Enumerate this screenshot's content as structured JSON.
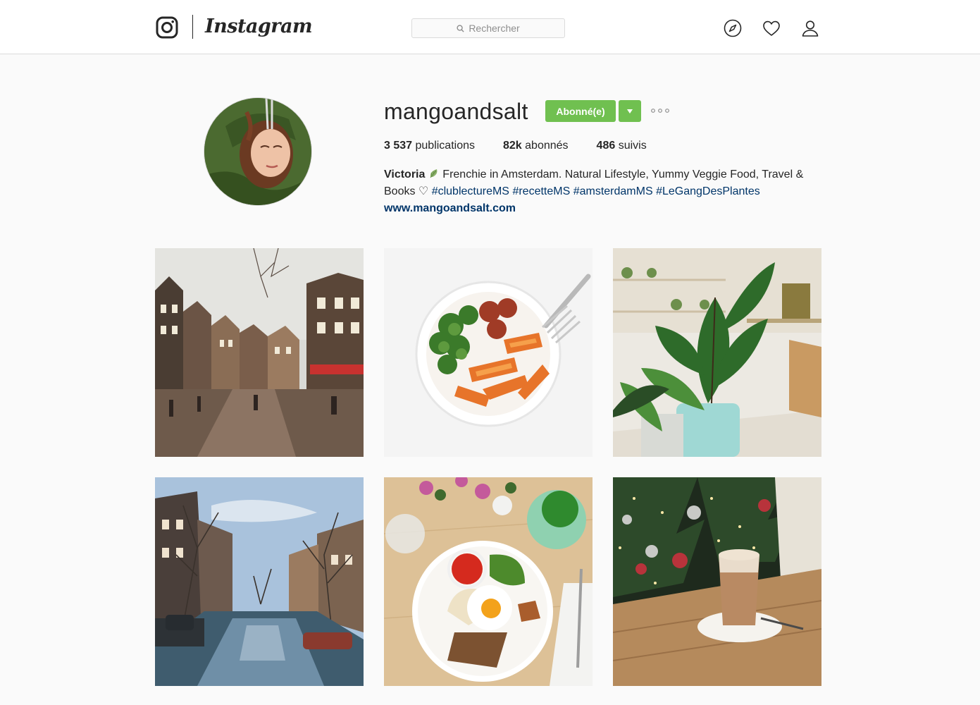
{
  "nav": {
    "brand": "Instagram",
    "search_placeholder": "Rechercher",
    "icons": [
      "explore-compass-icon",
      "activity-heart-icon",
      "profile-person-icon"
    ]
  },
  "profile": {
    "username": "mangoandsalt",
    "follow_label": "Abonné(e)",
    "stats": {
      "posts_count": "3 537",
      "posts_label": " publications",
      "followers_count": "82k",
      "followers_label": " abonnés",
      "following_count": "486",
      "following_label": " suivis"
    },
    "bio": {
      "name": "Victoria",
      "text_part1": " Frenchie in Amsterdam. Natural Lifestyle, Yummy Veggie Food, Travel & Books ♡ ",
      "hashtags": [
        "#clublectureMS",
        "#recetteMS",
        "#amsterdamMS",
        "#LeGangDesPlantes"
      ],
      "website": "www.mangoandsalt.com"
    }
  },
  "posts": [
    {
      "subject": "amsterdam-street"
    },
    {
      "subject": "veggie-bowl"
    },
    {
      "subject": "plant-shop"
    },
    {
      "subject": "amsterdam-canal"
    },
    {
      "subject": "brunch-plate"
    },
    {
      "subject": "latte-christmas-tree"
    }
  ],
  "colors": {
    "follow_green": "#70c050",
    "link_blue": "#003569",
    "page_bg": "#fafafa",
    "border": "#dbdbdb"
  }
}
